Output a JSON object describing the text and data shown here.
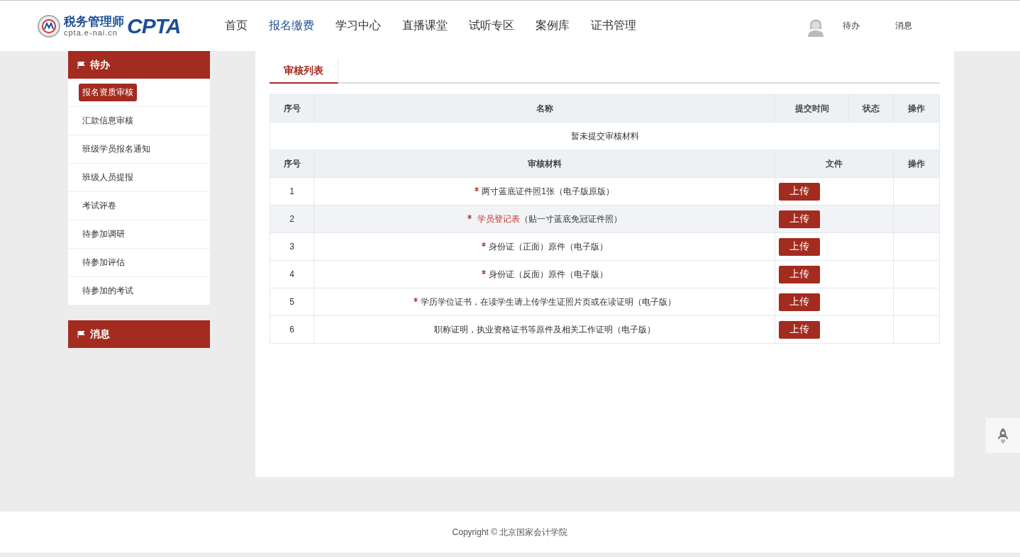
{
  "logo": {
    "title": "税务管理师",
    "domain": "cpta.e-nai.cn",
    "brand": "CPTA"
  },
  "nav": [
    {
      "label": "首页",
      "selected": false
    },
    {
      "label": "报名缴费",
      "selected": true
    },
    {
      "label": "学习中心",
      "selected": false
    },
    {
      "label": "直播课堂",
      "selected": false
    },
    {
      "label": "试听专区",
      "selected": false
    },
    {
      "label": "案例库",
      "selected": false
    },
    {
      "label": "证书管理",
      "selected": false
    }
  ],
  "user_links": [
    "待办",
    "消息"
  ],
  "sidebar": [
    {
      "title": "待办",
      "items": [
        {
          "label": "报名资质审核",
          "selected": true
        },
        {
          "label": "汇款信息审核",
          "selected": false
        },
        {
          "label": "班级学员报名通知",
          "selected": false
        },
        {
          "label": "班级人员提报",
          "selected": false
        },
        {
          "label": "考试评卷",
          "selected": false
        },
        {
          "label": "待参加调研",
          "selected": false
        },
        {
          "label": "待参加评估",
          "selected": false
        },
        {
          "label": "待参加的考试",
          "selected": false
        }
      ]
    },
    {
      "title": "消息"
    }
  ],
  "tabs": [
    {
      "label": "审核列表",
      "selected": true
    }
  ],
  "submissions": {
    "columns": [
      "序号",
      "名称",
      "提交时间",
      "状态",
      "操作"
    ],
    "empty": "暂未提交审核材料"
  },
  "materials": {
    "columns": [
      "序号",
      "审核材料",
      "文件",
      "操作"
    ],
    "rows": [
      {
        "index": "1",
        "required": true,
        "link": null,
        "text": "两寸蓝底证件照1张（电子版原版）",
        "button": "上传",
        "highlighted": false
      },
      {
        "index": "2",
        "required": true,
        "link": "学员登记表",
        "text": "（贴一寸蓝底免冠证件照）",
        "button": "上传",
        "highlighted": true
      },
      {
        "index": "3",
        "required": true,
        "link": null,
        "text": "身份证（正面）原件（电子版）",
        "button": "上传",
        "highlighted": false
      },
      {
        "index": "4",
        "required": true,
        "link": null,
        "text": "身份证（反面）原件（电子版）",
        "button": "上传",
        "highlighted": false
      },
      {
        "index": "5",
        "required": true,
        "link": null,
        "text": "学历学位证书，在读学生请上传学生证照片页或在读证明（电子版）",
        "button": "上传",
        "highlighted": false
      },
      {
        "index": "6",
        "required": false,
        "link": null,
        "text": "职称证明，执业资格证书等原件及相关工作证明（电子版）",
        "button": "上传",
        "highlighted": false
      }
    ]
  },
  "footer": "Copyright © 北京国家会计学院"
}
